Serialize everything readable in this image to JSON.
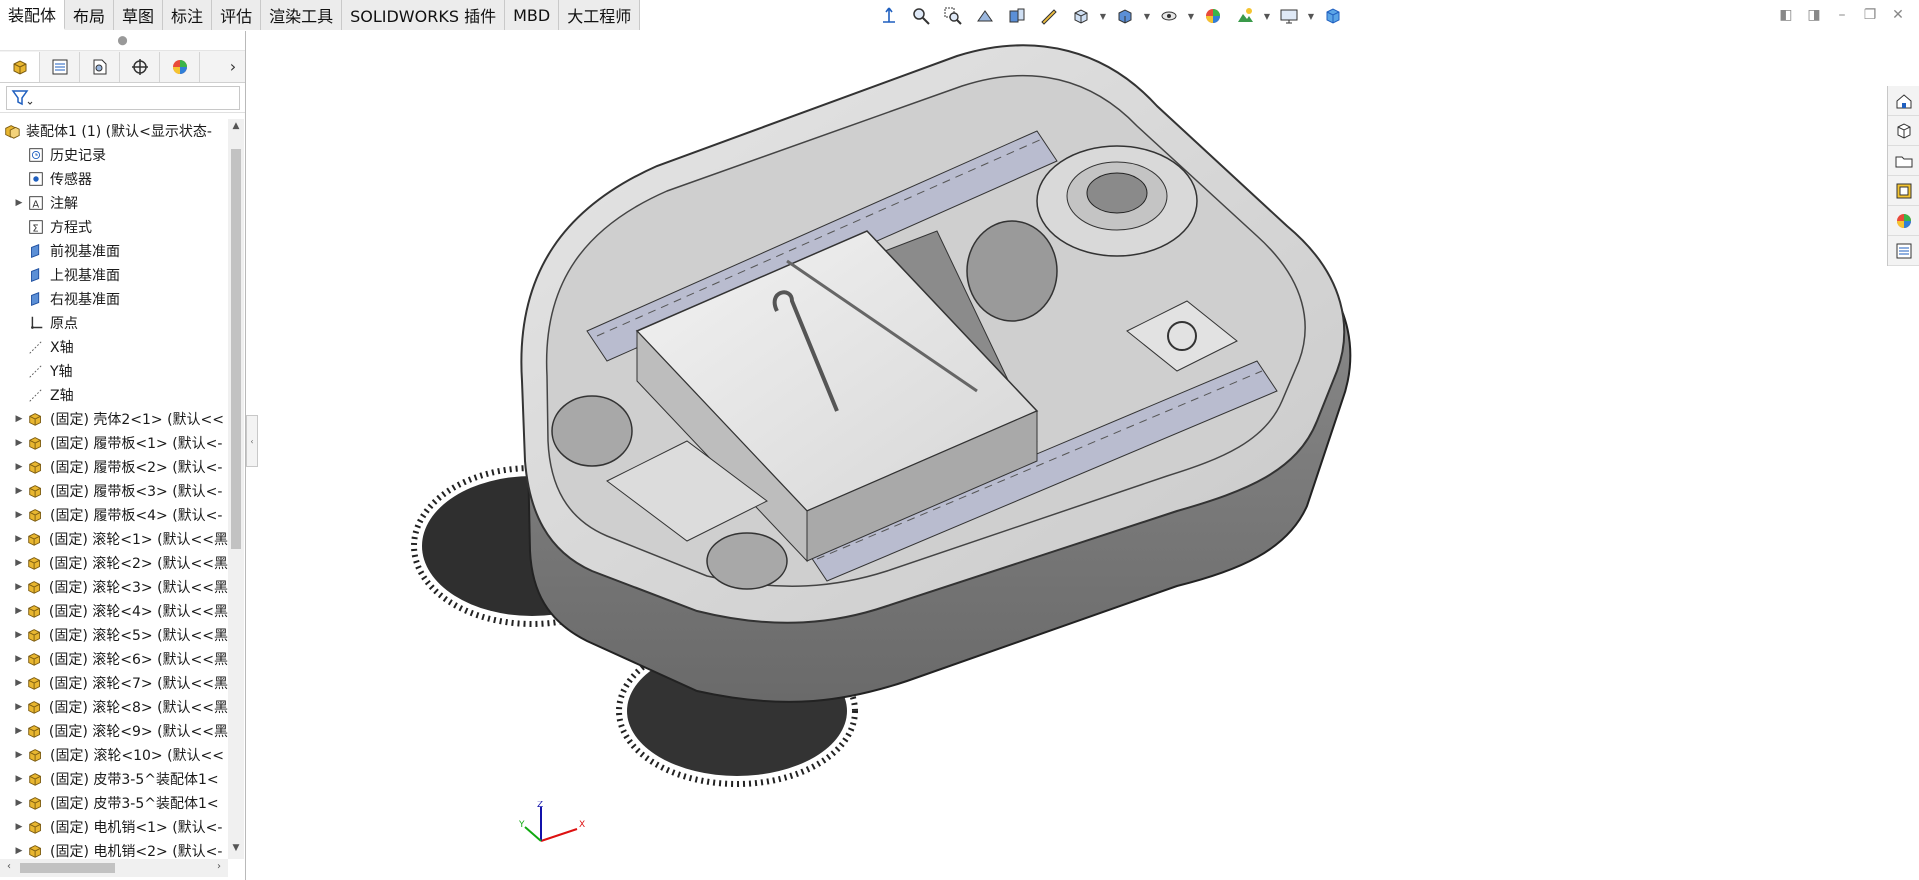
{
  "command_tabs": [
    "装配体",
    "布局",
    "草图",
    "标注",
    "评估",
    "渲染工具",
    "SOLIDWORKS 插件",
    "MBD",
    "大工程师"
  ],
  "active_tab": "装配体",
  "feature_tree": {
    "root": "装配体1 (1)  (默认<显示状态-",
    "items": [
      {
        "label": "历史记录",
        "icon": "history-icon",
        "expandable": false
      },
      {
        "label": "传感器",
        "icon": "sensor-icon",
        "expandable": false
      },
      {
        "label": "注解",
        "icon": "annotation-icon",
        "expandable": true
      },
      {
        "label": "方程式",
        "icon": "equation-icon",
        "expandable": false
      },
      {
        "label": "前视基准面",
        "icon": "plane-icon",
        "expandable": false
      },
      {
        "label": "上视基准面",
        "icon": "plane-icon",
        "expandable": false
      },
      {
        "label": "右视基准面",
        "icon": "plane-icon",
        "expandable": false
      },
      {
        "label": "原点",
        "icon": "origin-icon",
        "expandable": false
      },
      {
        "label": "X轴",
        "icon": "axis-icon",
        "expandable": false
      },
      {
        "label": "Y轴",
        "icon": "axis-icon",
        "expandable": false
      },
      {
        "label": "Z轴",
        "icon": "axis-icon",
        "expandable": false
      },
      {
        "label": "(固定) 壳体2<1> (默认<<",
        "icon": "part-icon",
        "expandable": true
      },
      {
        "label": "(固定) 履带板<1> (默认<-",
        "icon": "part-icon",
        "expandable": true
      },
      {
        "label": "(固定) 履带板<2> (默认<-",
        "icon": "part-icon",
        "expandable": true
      },
      {
        "label": "(固定) 履带板<3> (默认<-",
        "icon": "part-icon",
        "expandable": true
      },
      {
        "label": "(固定) 履带板<4> (默认<-",
        "icon": "part-icon",
        "expandable": true
      },
      {
        "label": "(固定) 滚轮<1> (默认<<黑",
        "icon": "part-icon",
        "expandable": true
      },
      {
        "label": "(固定) 滚轮<2> (默认<<黑",
        "icon": "part-icon",
        "expandable": true
      },
      {
        "label": "(固定) 滚轮<3> (默认<<黑",
        "icon": "part-icon",
        "expandable": true
      },
      {
        "label": "(固定) 滚轮<4> (默认<<黑",
        "icon": "part-icon",
        "expandable": true
      },
      {
        "label": "(固定) 滚轮<5> (默认<<黑",
        "icon": "part-icon",
        "expandable": true
      },
      {
        "label": "(固定) 滚轮<6> (默认<<黑",
        "icon": "part-icon",
        "expandable": true
      },
      {
        "label": "(固定) 滚轮<7> (默认<<黑",
        "icon": "part-icon",
        "expandable": true
      },
      {
        "label": "(固定) 滚轮<8> (默认<<黑",
        "icon": "part-icon",
        "expandable": true
      },
      {
        "label": "(固定) 滚轮<9> (默认<<黑",
        "icon": "part-icon",
        "expandable": true
      },
      {
        "label": "(固定) 滚轮<10> (默认<<",
        "icon": "part-icon",
        "expandable": true
      },
      {
        "label": "(固定) 皮带3-5^装配体1<",
        "icon": "part-icon",
        "expandable": true
      },
      {
        "label": "(固定) 皮带3-5^装配体1<",
        "icon": "part-icon",
        "expandable": true
      },
      {
        "label": "(固定) 电机销<1> (默认<-",
        "icon": "part-icon",
        "expandable": true
      },
      {
        "label": "(固定) 电机销<2> (默认<-",
        "icon": "part-icon",
        "expandable": true
      }
    ]
  },
  "triad": {
    "x": "X",
    "y": "Y",
    "z": "Z"
  },
  "colors": {
    "accent": "#1f5fbf",
    "part_yellow": "#e8b630"
  }
}
